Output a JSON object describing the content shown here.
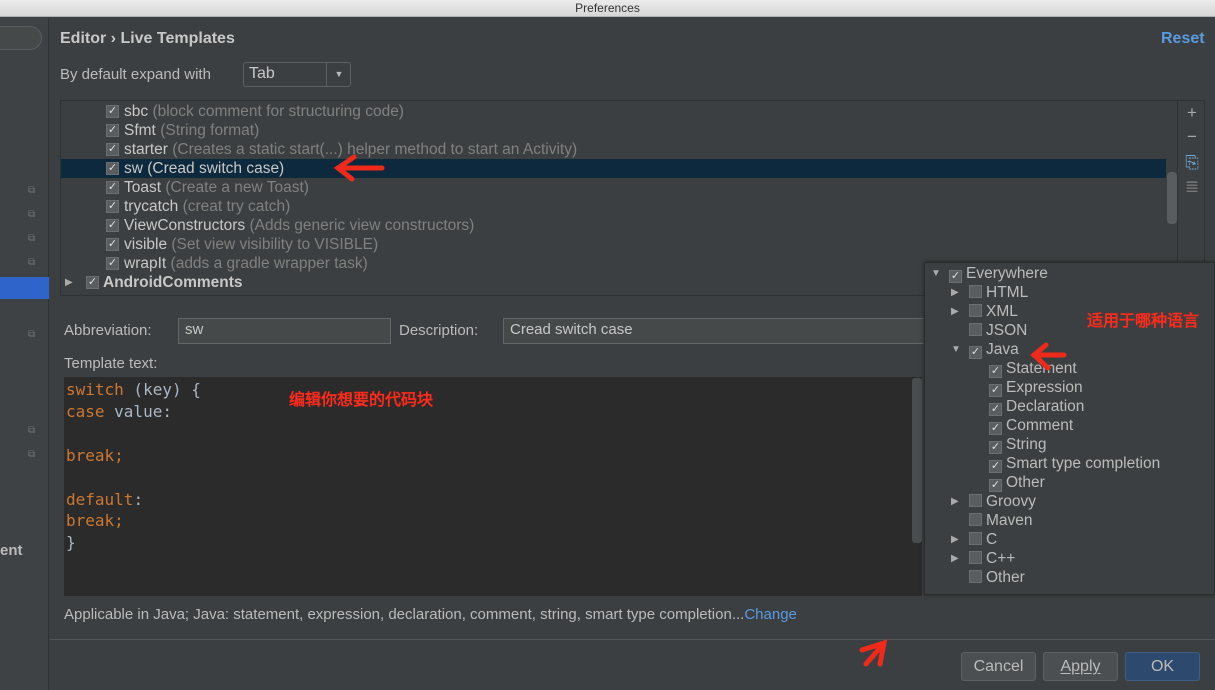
{
  "window": {
    "title": "Preferences"
  },
  "sidebar": {
    "partial_label": "ent"
  },
  "header": {
    "breadcrumb": "Editor › Live Templates",
    "reset": "Reset"
  },
  "expand": {
    "label": "By default expand with",
    "value": "Tab"
  },
  "templates": [
    {
      "name": "sbc",
      "desc": "(block comment for structuring code)",
      "checked": true
    },
    {
      "name": "Sfmt",
      "desc": "(String format)",
      "checked": true
    },
    {
      "name": "starter",
      "desc": "(Creates a static start(...) helper method to start an Activity)",
      "checked": true
    },
    {
      "name": "sw",
      "desc": "(Cread  switch case)",
      "checked": true,
      "selected": true
    },
    {
      "name": "Toast",
      "desc": "(Create a new Toast)",
      "checked": true
    },
    {
      "name": "trycatch",
      "desc": "(creat try catch)",
      "checked": true
    },
    {
      "name": "ViewConstructors",
      "desc": "(Adds generic view constructors)",
      "checked": true
    },
    {
      "name": "visible",
      "desc": "(Set view visibility to VISIBLE)",
      "checked": true
    },
    {
      "name": "wrapIt",
      "desc": "(adds a gradle wrapper task)",
      "checked": true
    }
  ],
  "group": {
    "name": "AndroidComments",
    "checked": true
  },
  "toolbar": {
    "icons": [
      "plus-icon",
      "minus-icon",
      "copy-icon",
      "text-icon"
    ]
  },
  "form": {
    "abbr_label": "Abbreviation:",
    "abbr_value": "sw",
    "desc_label": "Description:",
    "desc_value": "Cread  switch case",
    "template_label": "Template text:"
  },
  "editor": {
    "lines": [
      [
        {
          "t": "switch",
          "k": 1
        },
        {
          "t": " (key) {",
          "k": 0
        }
      ],
      [
        {
          "t": "case",
          "k": 1
        },
        {
          "t": " value:",
          "k": 0
        }
      ],
      [],
      [
        {
          "t": "break;",
          "k": 1
        }
      ],
      [],
      [
        {
          "t": "default",
          "k": 1
        },
        {
          "t": ":",
          "k": 0
        }
      ],
      [
        {
          "t": "break;",
          "k": 1
        }
      ],
      [
        {
          "t": "}",
          "k": 0
        }
      ]
    ]
  },
  "applicable": {
    "text": "Applicable in Java; Java: statement, expression, declaration, comment, string, smart type completion...",
    "link": "Change"
  },
  "buttons": {
    "cancel": "Cancel",
    "apply": "Apply",
    "ok": "OK"
  },
  "context_popup": [
    {
      "label": "Everywhere",
      "checked": true,
      "level": 0,
      "tw": "down"
    },
    {
      "label": "HTML",
      "checked": false,
      "level": 1,
      "tw": "right"
    },
    {
      "label": "XML",
      "checked": false,
      "level": 1,
      "tw": "right"
    },
    {
      "label": "JSON",
      "checked": false,
      "level": 1
    },
    {
      "label": "Java",
      "checked": true,
      "level": 1,
      "tw": "down"
    },
    {
      "label": "Statement",
      "checked": true,
      "level": 2
    },
    {
      "label": "Expression",
      "checked": true,
      "level": 2
    },
    {
      "label": "Declaration",
      "checked": true,
      "level": 2
    },
    {
      "label": "Comment",
      "checked": true,
      "level": 2
    },
    {
      "label": "String",
      "checked": true,
      "level": 2
    },
    {
      "label": "Smart type completion",
      "checked": true,
      "level": 2
    },
    {
      "label": "Other",
      "checked": true,
      "level": 2
    },
    {
      "label": "Groovy",
      "checked": false,
      "level": 1,
      "tw": "right"
    },
    {
      "label": "Maven",
      "checked": false,
      "level": 1
    },
    {
      "label": "C",
      "checked": false,
      "level": 1,
      "tw": "right"
    },
    {
      "label": "C++",
      "checked": false,
      "level": 1,
      "tw": "right"
    },
    {
      "label": "Other",
      "checked": false,
      "level": 1
    }
  ],
  "annotations": {
    "editor_note": "编辑你想要的代码块",
    "language_note": "适用于哪种语言"
  },
  "colors": {
    "accent": "#5a9be0",
    "selection": "#0d293e",
    "keyword": "#cc7832",
    "annotation": "#ff2a1a"
  }
}
